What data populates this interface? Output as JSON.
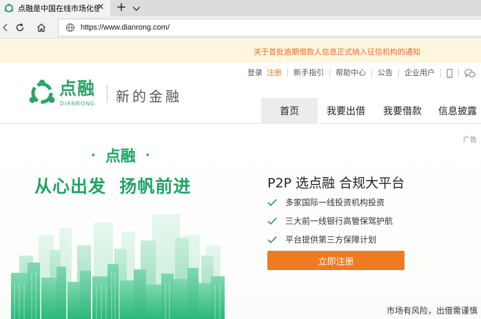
{
  "browser": {
    "tab_title": "点融是中国在线市场化借",
    "tab_close": "✕",
    "new_tab": "+",
    "url": "https://www.dianrong.com/"
  },
  "notice": {
    "text": "关于首批逾期借款人信息正式纳入征信机构的通知"
  },
  "header": {
    "logo_text": "点融",
    "logo_en": "DIANRONG",
    "slogan": "新的金融",
    "top_links": {
      "login": "登录",
      "register": "注册",
      "guide": "新手指引",
      "help": "帮助中心",
      "announcement": "公告",
      "enterprise": "企业用户"
    },
    "nav": [
      "首页",
      "我要出借",
      "我要借款",
      "信息披露"
    ]
  },
  "banner": {
    "ad_label": "广告",
    "brand_dot": "·",
    "brand": "点融",
    "headline": "从心出发  扬帆前进",
    "p2p_title": "P2P 选点融 合规大平台",
    "features": [
      "多家国际一线投资机构投资",
      "三大前一线银行高管保驾护航",
      "平台提供第三方保障计划"
    ],
    "cta": "立即注册",
    "risk": "市场有风险，出借需谨慎"
  },
  "colors": {
    "brand_green": "#2fa26b",
    "headline_green": "#20a464",
    "accent_orange": "#f07a22",
    "notice_bg": "#fff6de"
  },
  "icons": [
    "dianrong-favicon",
    "close-icon",
    "chevron-down-icon",
    "refresh-icon",
    "home-icon",
    "page-icon",
    "mobile-icon",
    "wechat-icon",
    "check-icon"
  ]
}
